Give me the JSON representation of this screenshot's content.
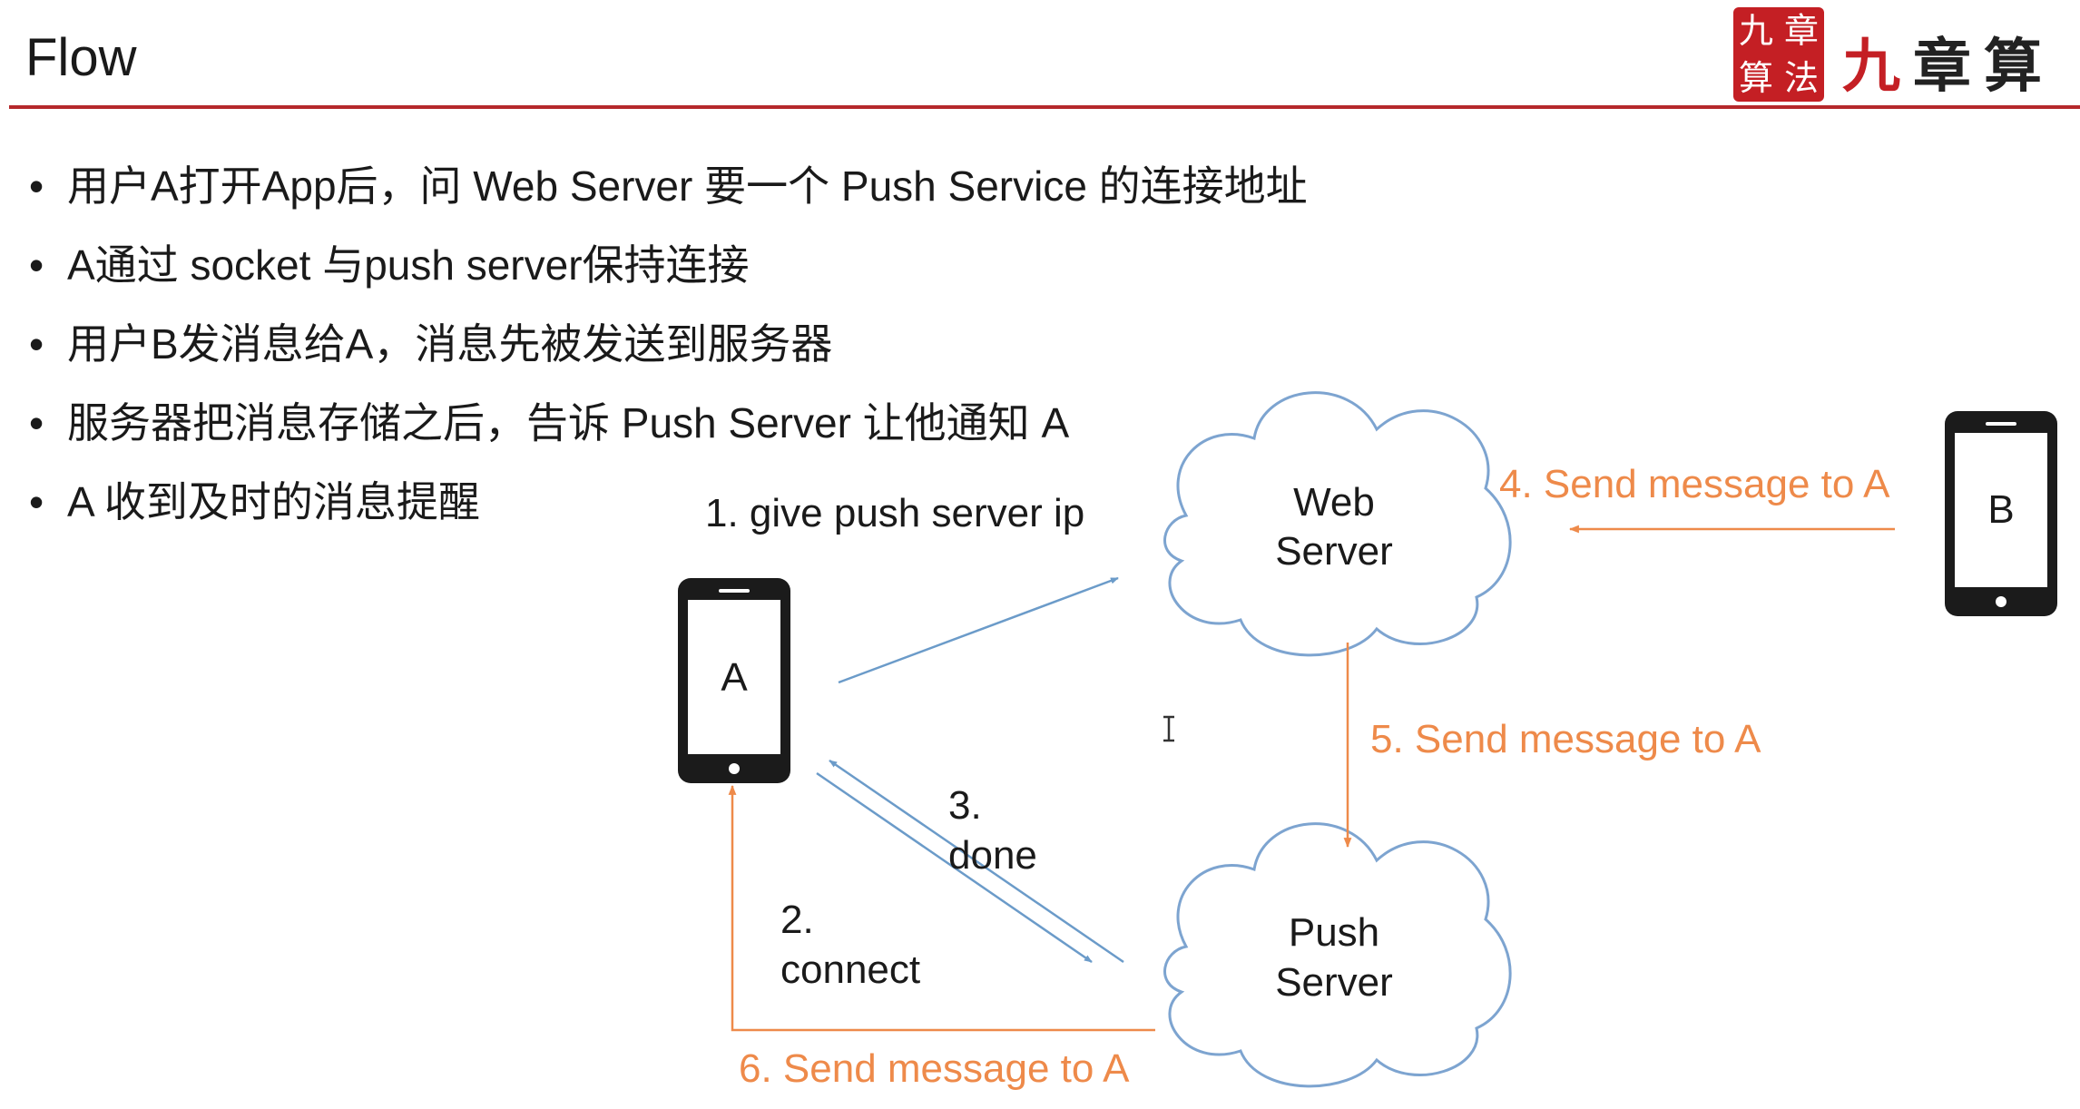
{
  "slide": {
    "title": "Flow"
  },
  "logo": {
    "seal_chars": [
      "九",
      "章",
      "算",
      "法"
    ],
    "brand_first": "九",
    "brand_rest": "章算"
  },
  "bullets": [
    "用户A打开App后，问 Web Server 要一个 Push Service 的连接地址",
    "A通过 socket 与push server保持连接",
    "用户B发消息给A，消息先被发送到服务器",
    "服务器把消息存储之后，告诉 Push Server 让他通知 A",
    "A 收到及时的消息提醒"
  ],
  "diagram": {
    "phone_a": "A",
    "phone_b": "B",
    "web_server": [
      "Web",
      "Server"
    ],
    "push_server": [
      "Push",
      "Server"
    ],
    "step1": "1. give push server ip",
    "step2": [
      "2.",
      "connect"
    ],
    "step3": [
      "3.",
      "done"
    ],
    "step4": "4. Send message to A",
    "step5": "5. Send message to A",
    "step6": "6. Send message to A"
  },
  "colors": {
    "accent_rule": "#b5282b",
    "blue_arrow": "#6b9bc9",
    "orange_arrow": "#ee8a4a",
    "cloud_stroke": "#7da4d0"
  }
}
